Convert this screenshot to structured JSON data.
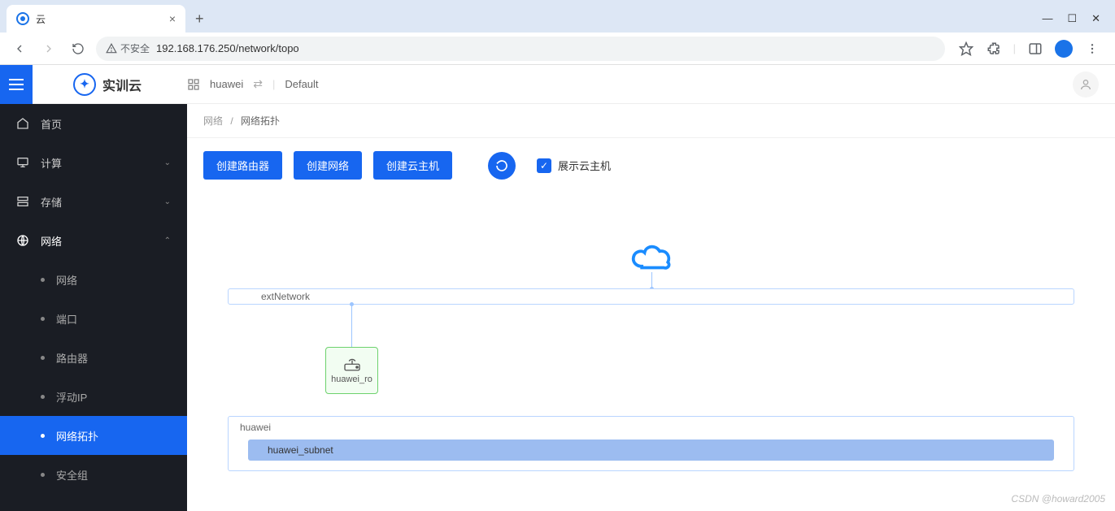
{
  "browser": {
    "tab_title": "云",
    "url_warn": "不安全",
    "url": "192.168.176.250/network/topo"
  },
  "app": {
    "logo_text": "实训云",
    "project": "huawei",
    "tenant": "Default"
  },
  "sidebar": {
    "items": [
      {
        "label": "首页",
        "icon": "home"
      },
      {
        "label": "计算",
        "icon": "monitor"
      },
      {
        "label": "存储",
        "icon": "storage"
      },
      {
        "label": "网络",
        "icon": "globe"
      }
    ],
    "network_children": [
      {
        "label": "网络"
      },
      {
        "label": "端口"
      },
      {
        "label": "路由器"
      },
      {
        "label": "浮动IP"
      },
      {
        "label": "网络拓扑"
      },
      {
        "label": "安全组"
      }
    ]
  },
  "breadcrumb": {
    "parent": "网络",
    "current": "网络拓扑"
  },
  "toolbar": {
    "create_router": "创建路由器",
    "create_network": "创建网络",
    "create_vm": "创建云主机",
    "show_vm_label": "展示云主机"
  },
  "topology": {
    "ext_network": "extNetwork",
    "router_name": "huawei_ro",
    "network_name": "huawei",
    "subnet_name": "huawei_subnet"
  },
  "watermark": "CSDN @howard2005"
}
